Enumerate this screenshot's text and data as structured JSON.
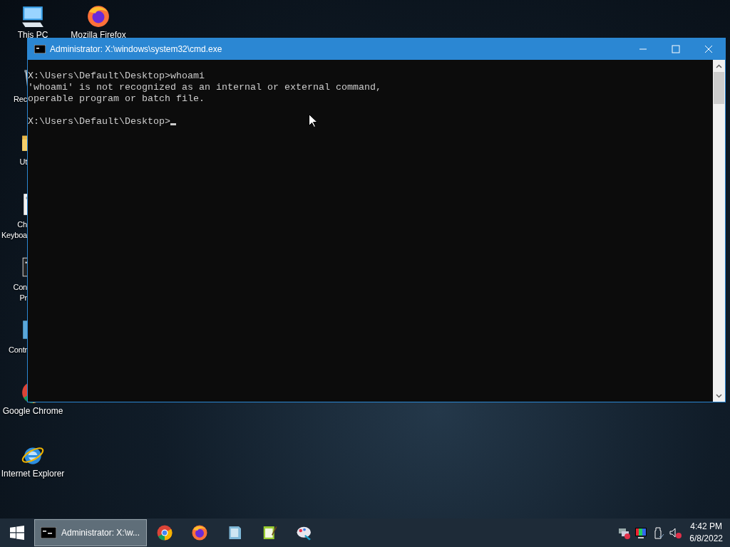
{
  "desktop": {
    "icons": [
      {
        "kind": "pc",
        "label": "This PC",
        "partial": false
      },
      {
        "kind": "recycle",
        "label": "Rec",
        "partial": true
      },
      {
        "kind": "folder",
        "label": "Ut",
        "partial": true
      },
      {
        "kind": "keyboard",
        "label": "Ch\nKeyboa",
        "partial": true
      },
      {
        "kind": "console",
        "label": "Con\nPr",
        "partial": true
      },
      {
        "kind": "control",
        "label": "Contr",
        "partial": true
      },
      {
        "kind": "chrome",
        "label": "Google Chrome",
        "partial": false
      },
      {
        "kind": "ie",
        "label": "Internet Explorer",
        "partial": false
      },
      {
        "kind": "firefox",
        "label": "Mozilla Firefox",
        "partial": false
      }
    ]
  },
  "window": {
    "title": "Administrator: X:\\windows\\system32\\cmd.exe",
    "console_paragraphs": [
      [
        "X:\\Users\\Default\\Desktop>whoami",
        "'whoami' is not recognized as an internal or external command,",
        "operable program or batch file."
      ],
      [
        "X:\\Users\\Default\\Desktop>"
      ]
    ]
  },
  "taskbar": {
    "task_button": {
      "label": "Administrator: X:\\w...",
      "selected": true
    },
    "pinned": [
      {
        "kind": "chrome"
      },
      {
        "kind": "firefox"
      },
      {
        "kind": "notepad"
      },
      {
        "kind": "editor"
      },
      {
        "kind": "paint"
      }
    ],
    "tray": [
      {
        "kind": "network"
      },
      {
        "kind": "display"
      },
      {
        "kind": "usb"
      },
      {
        "kind": "volume"
      }
    ],
    "time": "4:42 PM",
    "date": "6/8/2022"
  }
}
